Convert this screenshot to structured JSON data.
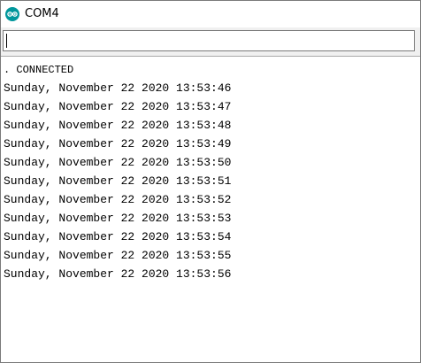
{
  "window": {
    "title": "COM4",
    "app_icon": "arduino-icon"
  },
  "input": {
    "value": ""
  },
  "output": {
    "lines": [
      ". CONNECTED",
      "Sunday, November 22 2020 13:53:46",
      "Sunday, November 22 2020 13:53:47",
      "Sunday, November 22 2020 13:53:48",
      "Sunday, November 22 2020 13:53:49",
      "Sunday, November 22 2020 13:53:50",
      "Sunday, November 22 2020 13:53:51",
      "Sunday, November 22 2020 13:53:52",
      "Sunday, November 22 2020 13:53:53",
      "Sunday, November 22 2020 13:53:54",
      "Sunday, November 22 2020 13:53:55",
      "Sunday, November 22 2020 13:53:56"
    ]
  },
  "colors": {
    "icon": "#00979c"
  }
}
